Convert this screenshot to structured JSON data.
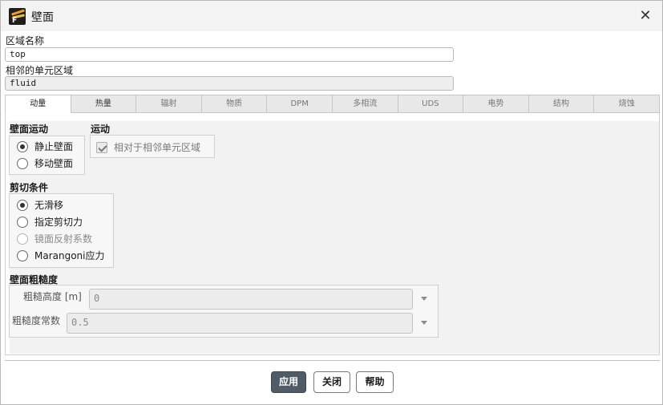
{
  "window": {
    "title": "壁面",
    "app_icon_letter": "F"
  },
  "zone_name": {
    "label": "区域名称",
    "value": "top"
  },
  "adjacent_zone": {
    "label": "相邻的单元区域",
    "value": "fluid"
  },
  "tabs": [
    {
      "label": "动量"
    },
    {
      "label": "热量"
    },
    {
      "label": "辐射"
    },
    {
      "label": "物质"
    },
    {
      "label": "DPM"
    },
    {
      "label": "多相流"
    },
    {
      "label": "UDS"
    },
    {
      "label": "电势"
    },
    {
      "label": "结构"
    },
    {
      "label": "烧蚀"
    }
  ],
  "wall_motion": {
    "title": "壁面运动",
    "options": [
      {
        "label": "静止壁面",
        "checked": true
      },
      {
        "label": "移动壁面",
        "checked": false
      }
    ]
  },
  "motion": {
    "title": "运动",
    "relative_label": "相对于相邻单元区域"
  },
  "shear": {
    "title": "剪切条件",
    "options": [
      {
        "label": "无滑移"
      },
      {
        "label": "指定剪切力"
      },
      {
        "label": "镜面反射系数"
      },
      {
        "label": "Marangoni应力"
      }
    ]
  },
  "roughness": {
    "title": "壁面粗糙度",
    "height_label": "粗糙高度 [m]",
    "height_value": "0",
    "constant_label": "粗糙度常数",
    "constant_value": "0.5"
  },
  "buttons": {
    "apply": "应用",
    "close": "关闭",
    "help": "帮助"
  }
}
